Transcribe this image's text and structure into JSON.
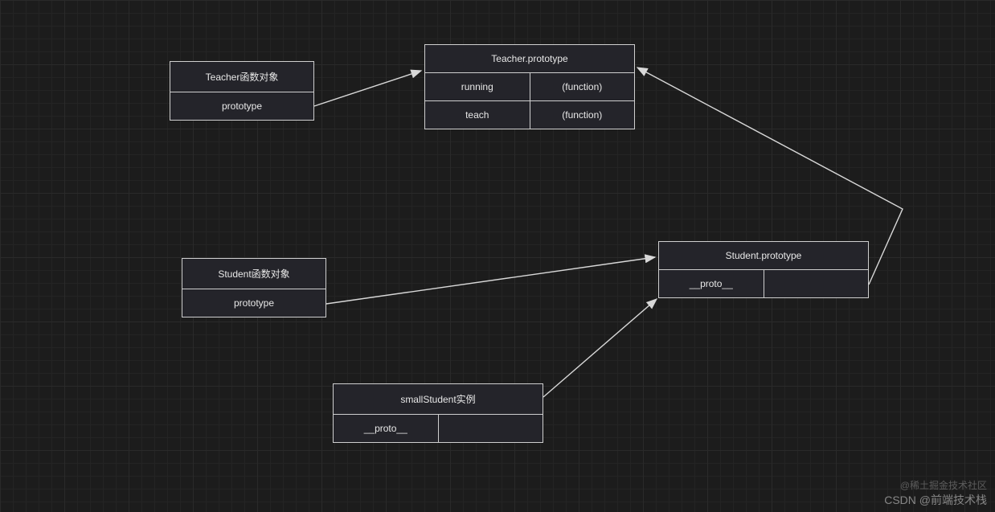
{
  "nodes": {
    "teacherFn": {
      "title": "Teacher函数对象",
      "slot": "prototype"
    },
    "teacherProto": {
      "title": "Teacher.prototype",
      "rows": [
        {
          "key": "running",
          "val": "(function)"
        },
        {
          "key": "teach",
          "val": "(function)"
        }
      ]
    },
    "studentFn": {
      "title": "Student函数对象",
      "slot": "prototype"
    },
    "studentProto": {
      "title": "Student.prototype",
      "slot": "__proto__"
    },
    "instance": {
      "title": "smallStudent实例",
      "slot": "__proto__"
    }
  },
  "watermark": {
    "top": "@稀土掘金技术社区",
    "bottom": "CSDN @前端技术栈"
  }
}
